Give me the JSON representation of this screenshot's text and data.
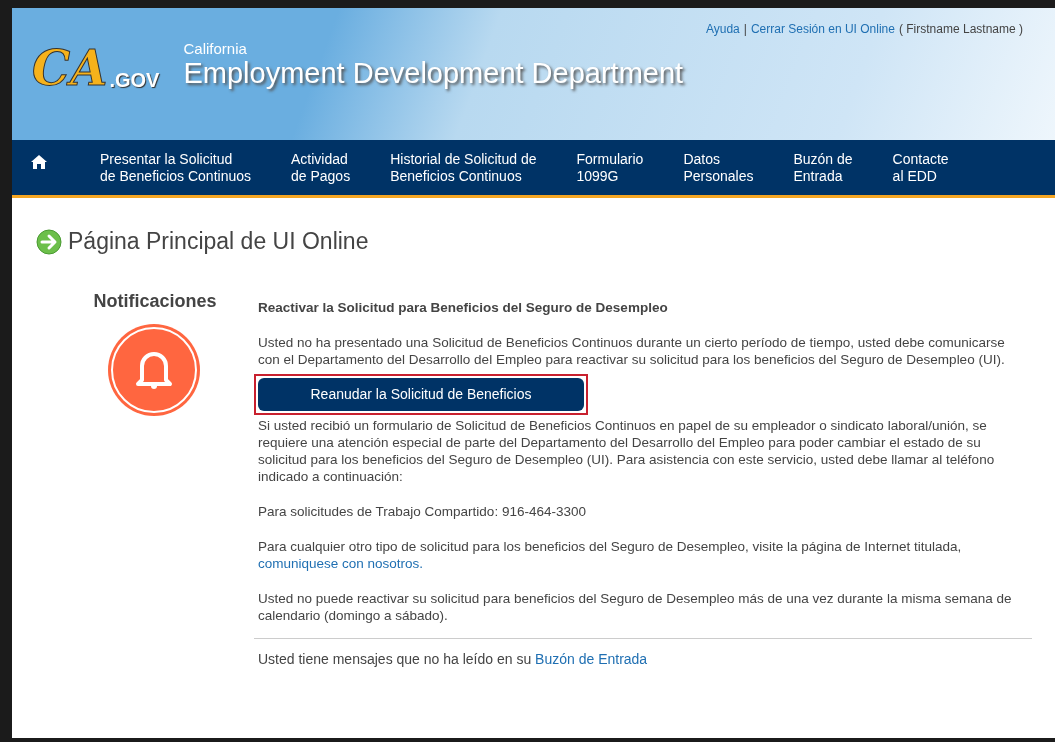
{
  "header": {
    "separator": "|",
    "links": [
      {
        "label": "Ayuda",
        "kind": "link"
      },
      {
        "label": "Cerrar Sesión en UI Online",
        "kind": "link"
      }
    ],
    "user": "( Firstname Lastname )",
    "logo": {
      "mark": "CA",
      "suffix": ".GOV"
    },
    "subtitle": "California",
    "title": "Employment Development Department"
  },
  "nav": [
    {
      "line1": "Presentar la Solicitud",
      "line2": "de Beneficios Continuos"
    },
    {
      "line1": "Actividad",
      "line2": "de Pagos"
    },
    {
      "line1": "Historial de Solicitud de",
      "line2": "Beneficios Continuos"
    },
    {
      "line1": "Formulario",
      "line2": "1099G"
    },
    {
      "line1": "Datos",
      "line2": "Personales"
    },
    {
      "line1": "Buzón de",
      "line2": "Entrada"
    },
    {
      "line1": "Contacte",
      "line2": "al EDD"
    }
  ],
  "page_title": "Página Principal de UI Online",
  "notifications": {
    "heading": "Notificaciones"
  },
  "notice": {
    "title": "Reactivar la Solicitud para Beneficios del Seguro de Desempleo",
    "intro": "Usted no ha presentado una Solicitud de Beneficios Continuos durante un cierto período de tiempo, usted debe comunicarse con el Departamento del Desarrollo del Empleo para reactivar su solicitud para los beneficios del Seguro de Desempleo (UI).",
    "button": {
      "label": "Reanudar la Solicitud de Beneficios",
      "highlighted": true
    },
    "paragraphs": [
      {
        "text": "Si usted recibió un formulario de Solicitud de Beneficios Continuos en papel de su empleador o sindicato laboral/unión, se requiere una atención especial de parte del Departamento del Desarrollo del Empleo para poder cambiar el estado de su solicitud para los beneficios del Seguro de Desempleo (UI). Para asistencia con este servicio, usted debe llamar al teléfono indicado a continuación:"
      },
      {
        "text": "Para solicitudes de Trabajo Compartido: 916-464-3300"
      },
      {
        "text": "Para cualquier otro tipo de solicitud para los beneficios del Seguro de Desempleo, visite la página de Internet titulada, ",
        "link": "comuniquese con nosotros."
      },
      {
        "text": "Usted no puede reactivar su solicitud para beneficios del Seguro de Desempleo más de una vez durante la misma semana de calendario (domingo a sábado)."
      }
    ]
  },
  "footer_message": {
    "text": "Usted tiene mensajes que no ha leído en su ",
    "link": "Buzón de Entrada"
  }
}
